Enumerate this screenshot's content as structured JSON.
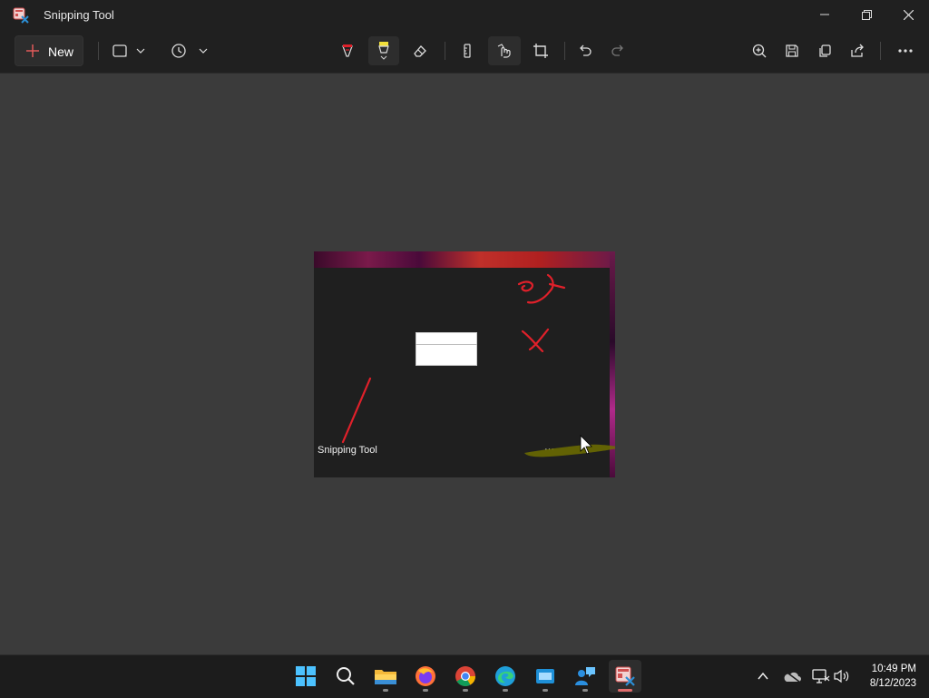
{
  "window": {
    "title": "Snipping Tool"
  },
  "toolbar": {
    "new_label": "New"
  },
  "snip": {
    "caption": "Snipping Tool",
    "dots": "···"
  },
  "clock": {
    "time": "10:49 PM",
    "date": "8/12/2023"
  },
  "colors": {
    "ink_red": "#e0202a",
    "highlighter": "#8a8a00",
    "accent": "#e06c6c"
  },
  "icons": {
    "toolbar": [
      "plus-icon",
      "snip-mode-icon",
      "chevron-down-icon",
      "timer-icon",
      "chevron-down-icon",
      "ballpoint-pen-icon",
      "highlighter-icon",
      "eraser-icon",
      "ruler-icon",
      "touch-writing-icon",
      "crop-icon",
      "undo-icon",
      "redo-icon",
      "zoom-in-icon",
      "save-icon",
      "copy-icon",
      "share-icon",
      "more-icon"
    ],
    "taskbar": [
      "windows-start-icon",
      "search-icon",
      "file-explorer-icon",
      "firefox-icon",
      "chrome-icon",
      "edge-icon",
      "app-window-icon",
      "remote-assist-icon",
      "snipping-tool-icon"
    ],
    "tray": [
      "chevron-up-icon",
      "onedrive-icon",
      "network-icon",
      "volume-icon"
    ]
  }
}
